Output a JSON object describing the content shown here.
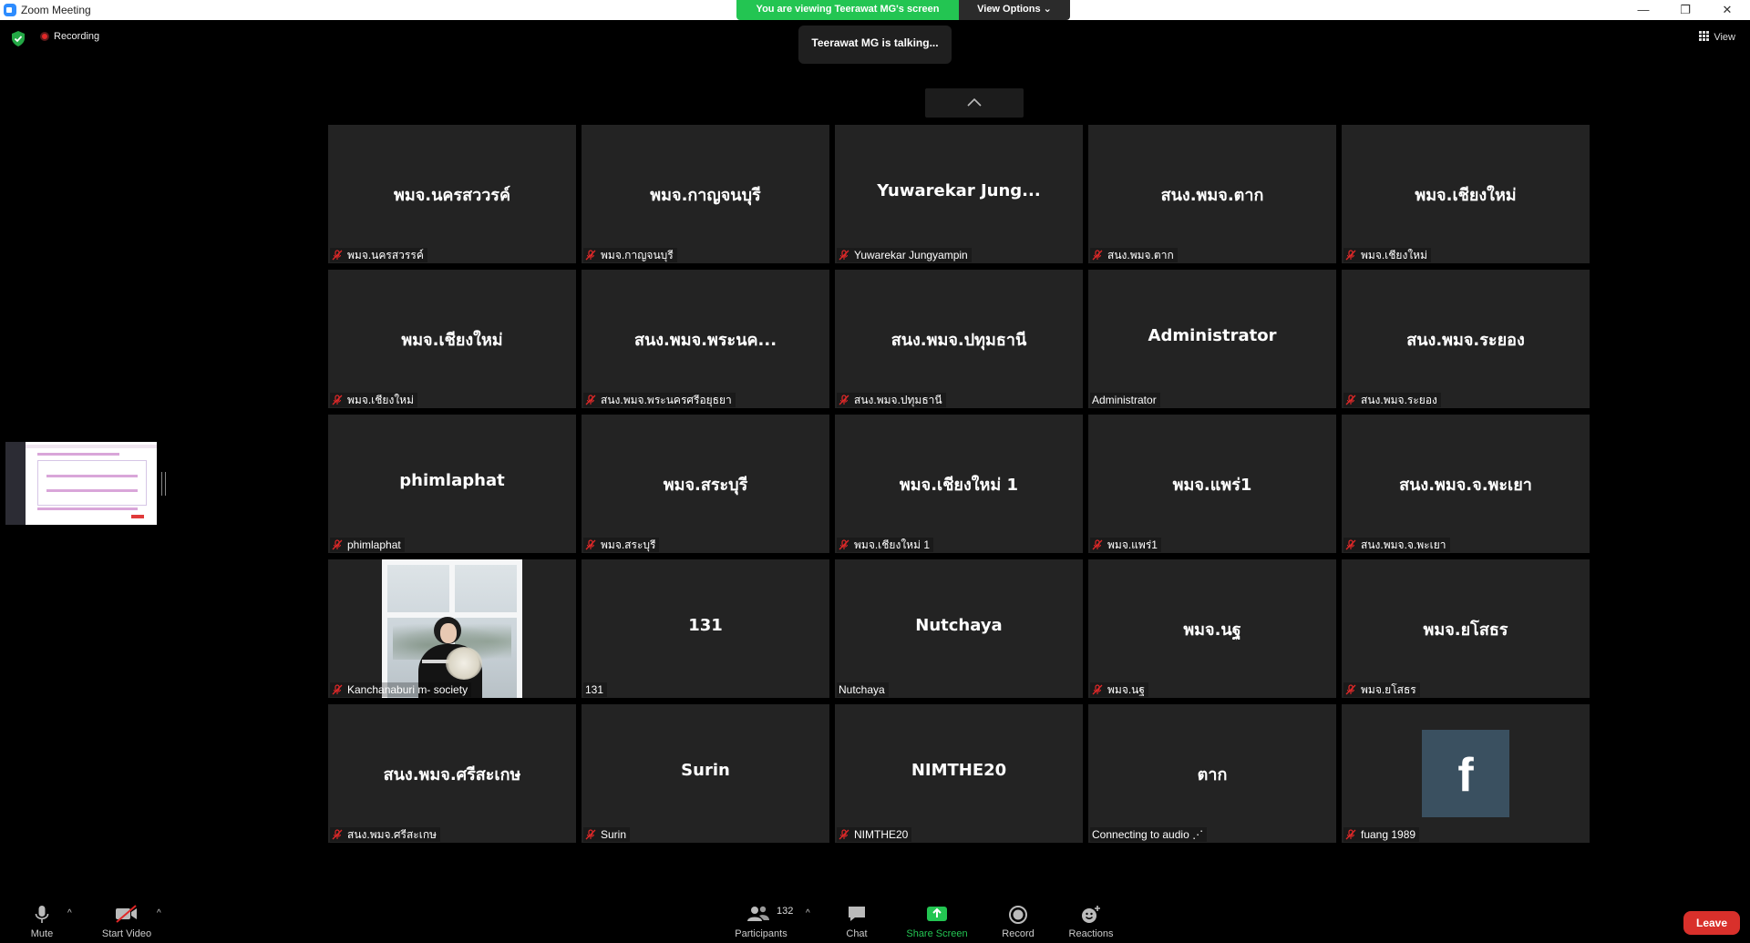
{
  "window": {
    "title": "Zoom Meeting",
    "controls": {
      "minimize": "—",
      "restore": "❐",
      "close": "✕"
    }
  },
  "share_banner": {
    "viewing_text": "You are viewing Teerawat MG's screen",
    "view_options_label": "View Options ⌄"
  },
  "status": {
    "recording_label": "Recording",
    "talking_text": "Teerawat MG is talking...",
    "view_label": "View"
  },
  "tiles": [
    {
      "center": "พมจ.นครสววรค์",
      "label": "พมจ.นครสวรรค์",
      "muted": true
    },
    {
      "center": "พมจ.กาญจนบุรี",
      "label": "พมจ.กาญจนบุรี",
      "muted": true
    },
    {
      "center": "Yuwarekar Jung...",
      "label": "Yuwarekar Jungyampin",
      "muted": true
    },
    {
      "center": "สนง.พมจ.ตาก",
      "label": "สนง.พมจ.ตาก",
      "muted": true
    },
    {
      "center": "พมจ.เชียงใหม่",
      "label": "พมจ.เชียงใหม่",
      "muted": true
    },
    {
      "center": "พมจ.เชียงใหม่",
      "label": "พมจ.เชียงใหม่",
      "muted": true
    },
    {
      "center": "สนง.พมจ.พระนค...",
      "label": "สนง.พมจ.พระนครศรีอยุธยา",
      "muted": true
    },
    {
      "center": "สนง.พมจ.ปทุมธานี",
      "label": "สนง.พมจ.ปทุมธานี",
      "muted": true
    },
    {
      "center": "Administrator",
      "label": "Administrator",
      "muted": false
    },
    {
      "center": "สนง.พมจ.ระยอง",
      "label": "สนง.พมจ.ระยอง",
      "muted": true
    },
    {
      "center": "phimlaphat",
      "label": "phimlaphat",
      "muted": true
    },
    {
      "center": "พมจ.สระบุรี",
      "label": "พมจ.สระบุรี",
      "muted": true
    },
    {
      "center": "พมจ.เชียงใหม่ 1",
      "label": "พมจ.เชียงใหม่ 1",
      "muted": true
    },
    {
      "center": "พมจ.แพร่1",
      "label": "พมจ.แพร่1",
      "muted": true
    },
    {
      "center": "สนง.พมจ.จ.พะเยา",
      "label": "สนง.พมจ.จ.พะเยา",
      "muted": true
    },
    {
      "center": "",
      "label": "Kanchanaburi m- society",
      "muted": true,
      "photo": true
    },
    {
      "center": "131",
      "label": "131",
      "muted": false
    },
    {
      "center": "Nutchaya",
      "label": "Nutchaya",
      "muted": false
    },
    {
      "center": "พมจ.นฐ",
      "label": "พมจ.นฐ",
      "muted": true
    },
    {
      "center": "พมจ.ยโสธร",
      "label": "พมจ.ยโสธร",
      "muted": true
    },
    {
      "center": "สนง.พมจ.ศรีสะเกษ",
      "label": "สนง.พมจ.ศรีสะเกษ",
      "muted": true
    },
    {
      "center": "Surin",
      "label": "Surin",
      "muted": true
    },
    {
      "center": "NIMTHE20",
      "label": "NIMTHE20",
      "muted": true
    },
    {
      "center": "ตาก",
      "label": "Connecting to audio ⋰",
      "muted": false
    },
    {
      "center": "",
      "label": "fuang 1989",
      "muted": true,
      "avatar_letter": "f"
    }
  ],
  "toolbar": {
    "mute_label": "Mute",
    "start_video_label": "Start Video",
    "participants_label": "Participants",
    "participants_count": "132",
    "chat_label": "Chat",
    "share_screen_label": "Share Screen",
    "record_label": "Record",
    "reactions_label": "Reactions",
    "leave_label": "Leave",
    "caret": "^"
  },
  "colors": {
    "share_green": "#23c552",
    "leave_red": "#d9302b",
    "muted_red": "#e02828",
    "tile_bg": "#232323"
  }
}
